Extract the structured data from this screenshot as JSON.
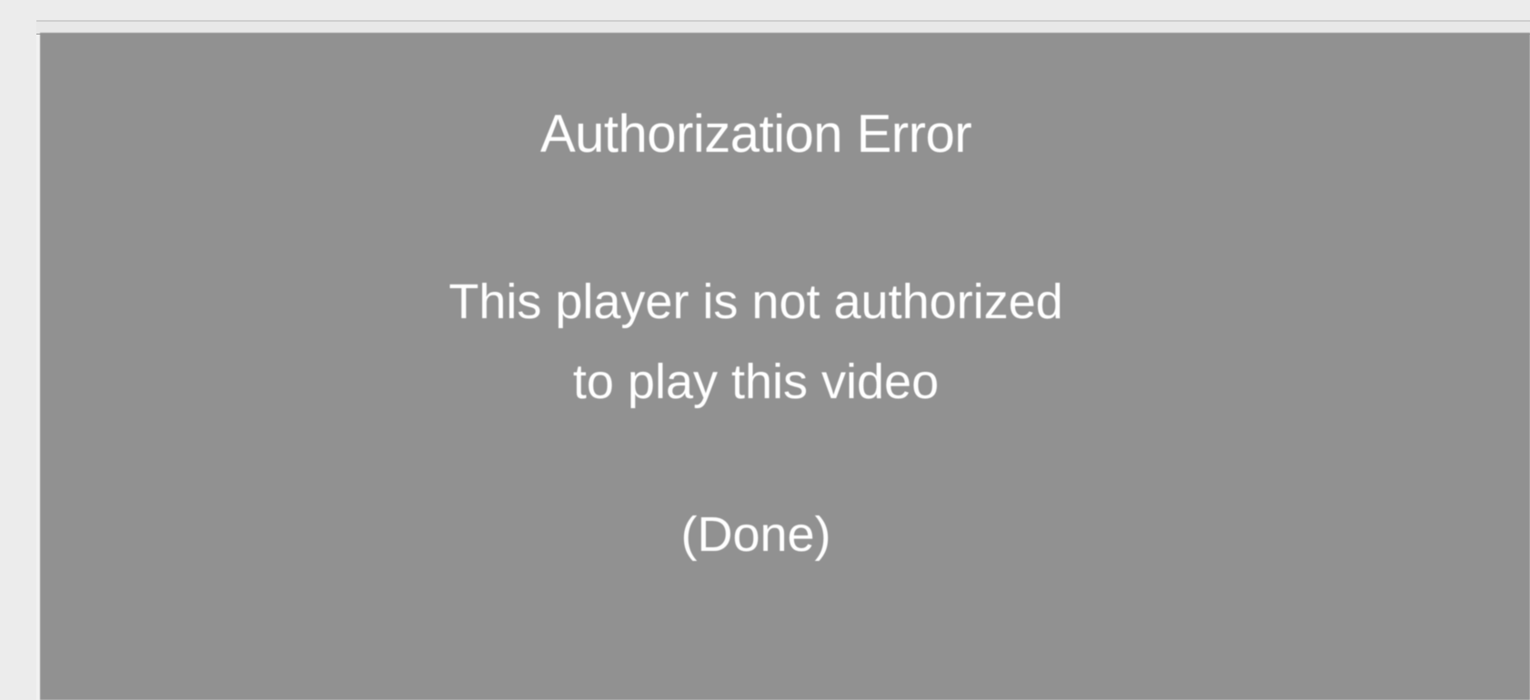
{
  "dialog": {
    "title": "Authorization Error",
    "message_lines": [
      "This player is not authorized",
      "to play this video"
    ],
    "done_label": "(Done)"
  },
  "colors": {
    "page_background": "#ececec",
    "video_background": "#919191",
    "text": "#ffffff"
  }
}
